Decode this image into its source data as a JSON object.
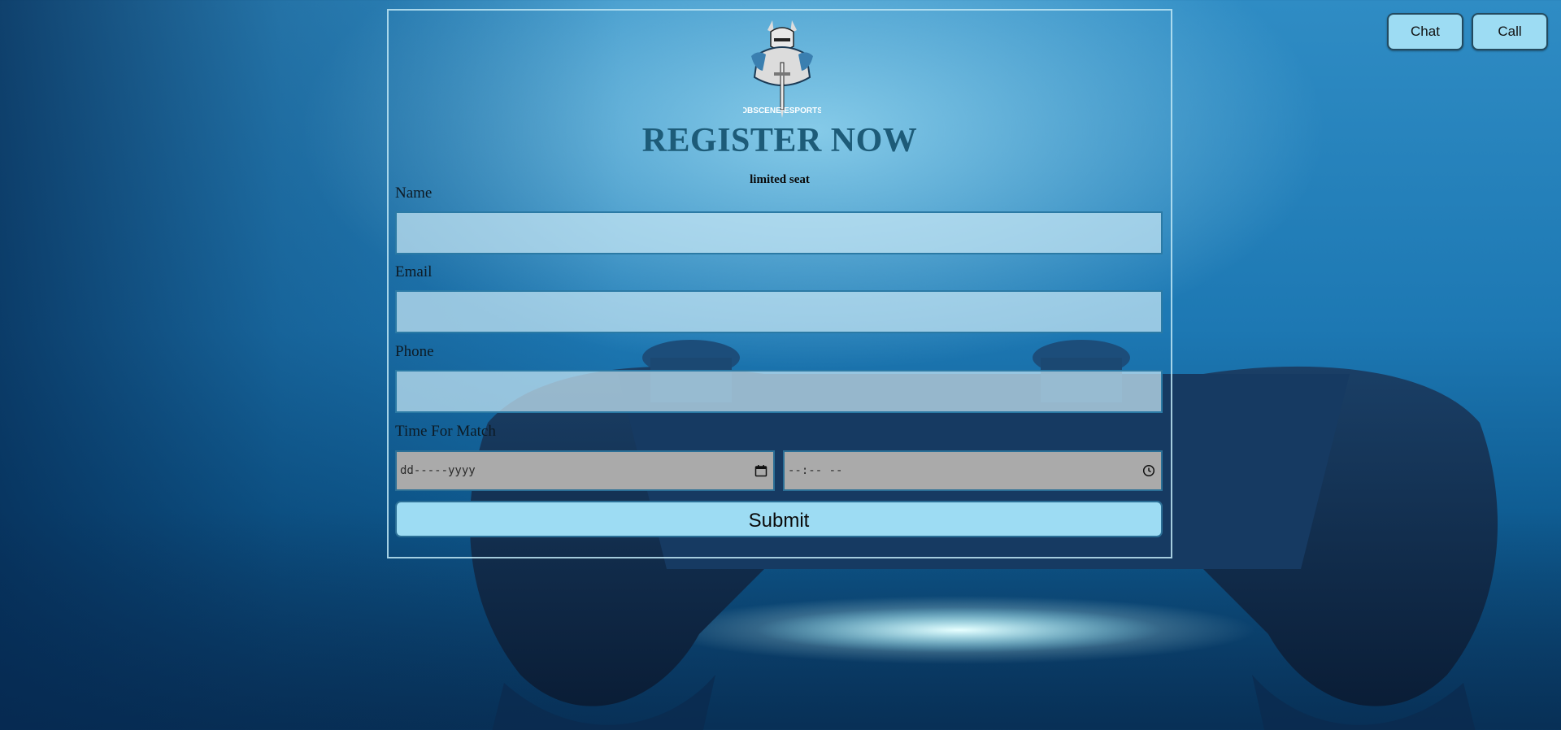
{
  "top_buttons": {
    "chat_label": "Chat",
    "call_label": "Call"
  },
  "logo": {
    "text_left": "OBSCENE",
    "text_right": "ESPORTS"
  },
  "form": {
    "title": "REGISTER NOW",
    "subtitle": "limited seat",
    "name_label": "Name",
    "email_label": "Email",
    "phone_label": "Phone",
    "time_label": "Time For Match",
    "date_placeholder": "dd-----yyyy",
    "time_placeholder": "--:-- --",
    "submit_label": "Submit"
  },
  "colors": {
    "accent_button": "#9ddcf3",
    "title": "#1d5b78",
    "input_border": "#2b7aa5"
  },
  "icons": {
    "date": "calendar-icon",
    "time": "clock-icon"
  }
}
